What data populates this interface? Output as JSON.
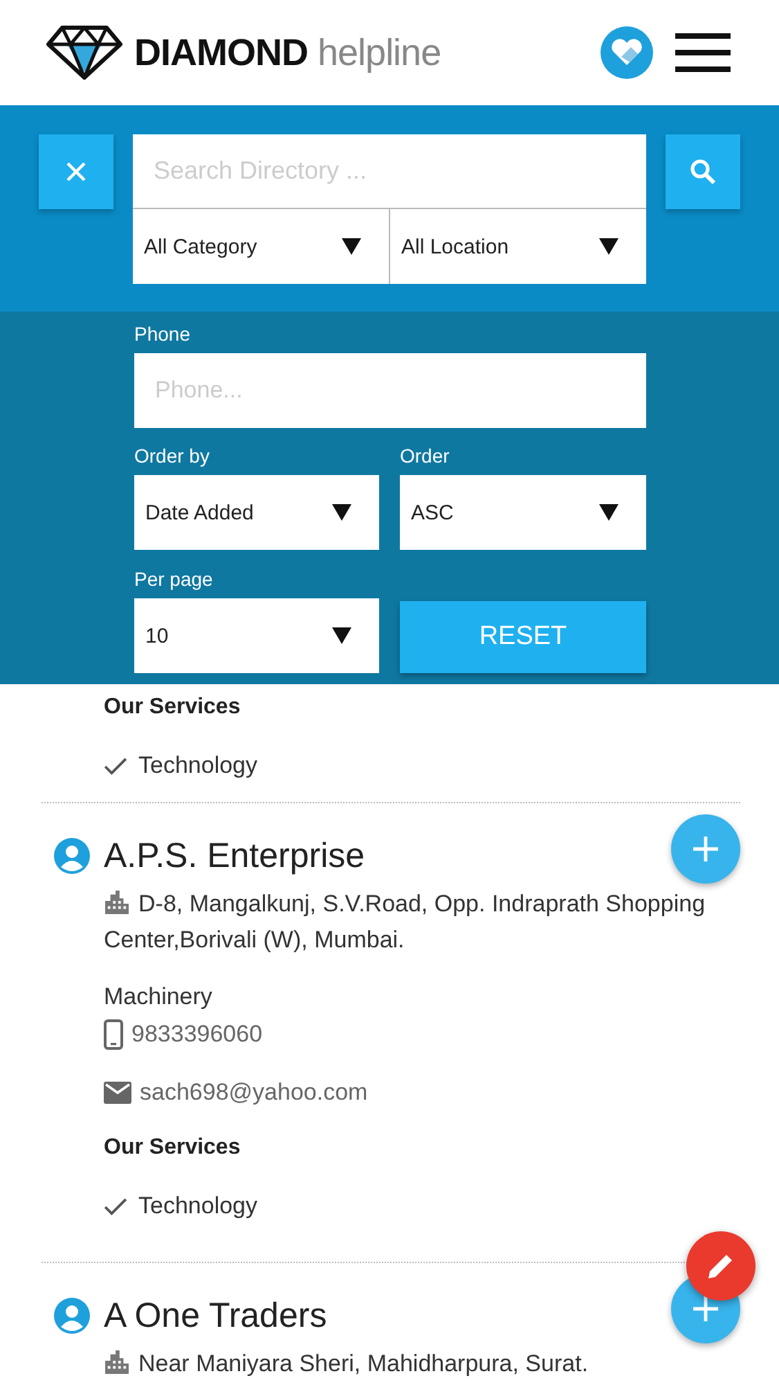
{
  "header": {
    "brand_bold": "DIAMOND",
    "brand_light": "helpline"
  },
  "search": {
    "placeholder": "Search Directory ...",
    "category": "All Category",
    "location": "All Location"
  },
  "filters": {
    "phone_label": "Phone",
    "phone_placeholder": "Phone...",
    "order_by_label": "Order by",
    "order_by": "Date Added",
    "order_label": "Order",
    "order": "ASC",
    "per_page_label": "Per page",
    "per_page": "10",
    "reset": "RESET"
  },
  "listings": [
    {
      "services_heading": "Our Services",
      "services": [
        "Technology"
      ]
    },
    {
      "name": "A.P.S. Enterprise",
      "address": "D-8, Mangalkunj, S.V.Road, Opp. Indraprath Shopping Center,Borivali (W), Mumbai.",
      "category": "Machinery",
      "phone": "9833396060",
      "email": "sach698@yahoo.com",
      "services_heading": "Our Services",
      "services": [
        "Technology"
      ]
    },
    {
      "name": "A One Traders",
      "address": "Near Maniyara Sheri, Mahidharpura, Surat."
    }
  ]
}
